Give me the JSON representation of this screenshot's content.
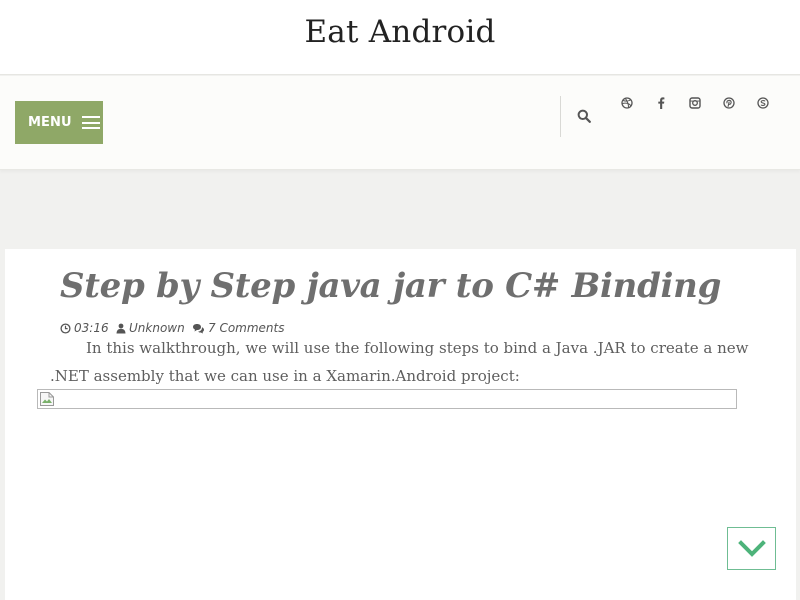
{
  "site": {
    "title": "Eat Android"
  },
  "nav": {
    "menu_label": "MENU",
    "accent_color": "#8fa867",
    "social_icons": [
      "dribbble-icon",
      "facebook-icon",
      "instagram-icon",
      "pinterest-icon",
      "skype-icon"
    ]
  },
  "post": {
    "title": "Step by Step java jar to C# Binding",
    "meta": {
      "time": "03:16",
      "author": "Unknown",
      "comments": "7 Comments"
    },
    "body": "In this walkthrough, we will use the following steps to bind a Java .JAR to create a new .NET assembly that we can use in a Xamarin.Android project:"
  },
  "scroll_top": {
    "icon": "chevron-down-icon",
    "color": "#4db37a"
  }
}
